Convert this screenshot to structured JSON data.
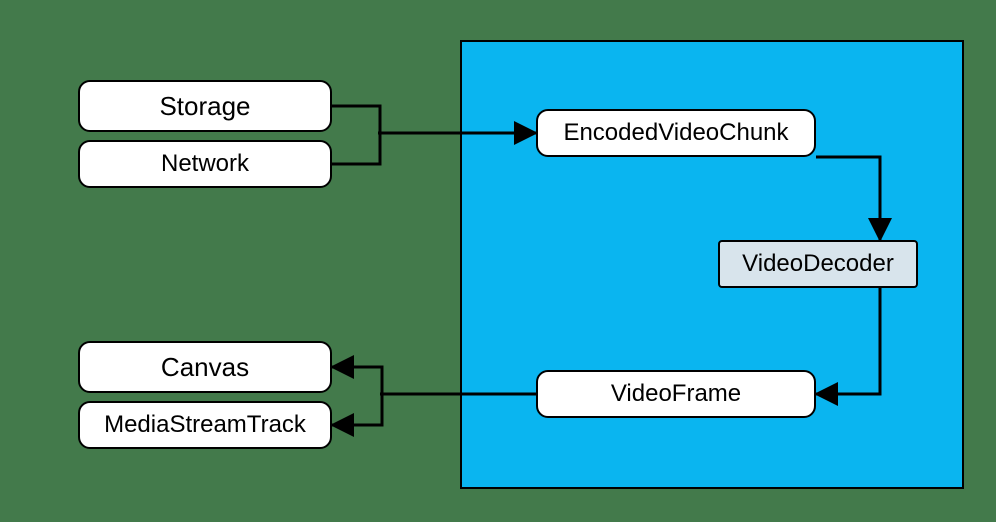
{
  "diagram": {
    "nodes": {
      "storage": "Storage",
      "network": "Network",
      "encodedChunk": "EncodedVideoChunk",
      "decoder": "VideoDecoder",
      "videoFrame": "VideoFrame",
      "canvas": "Canvas",
      "mst": "MediaStreamTrack"
    },
    "highlightColor": "#0ab5f0",
    "decoderFill": "#d8e4ec"
  }
}
